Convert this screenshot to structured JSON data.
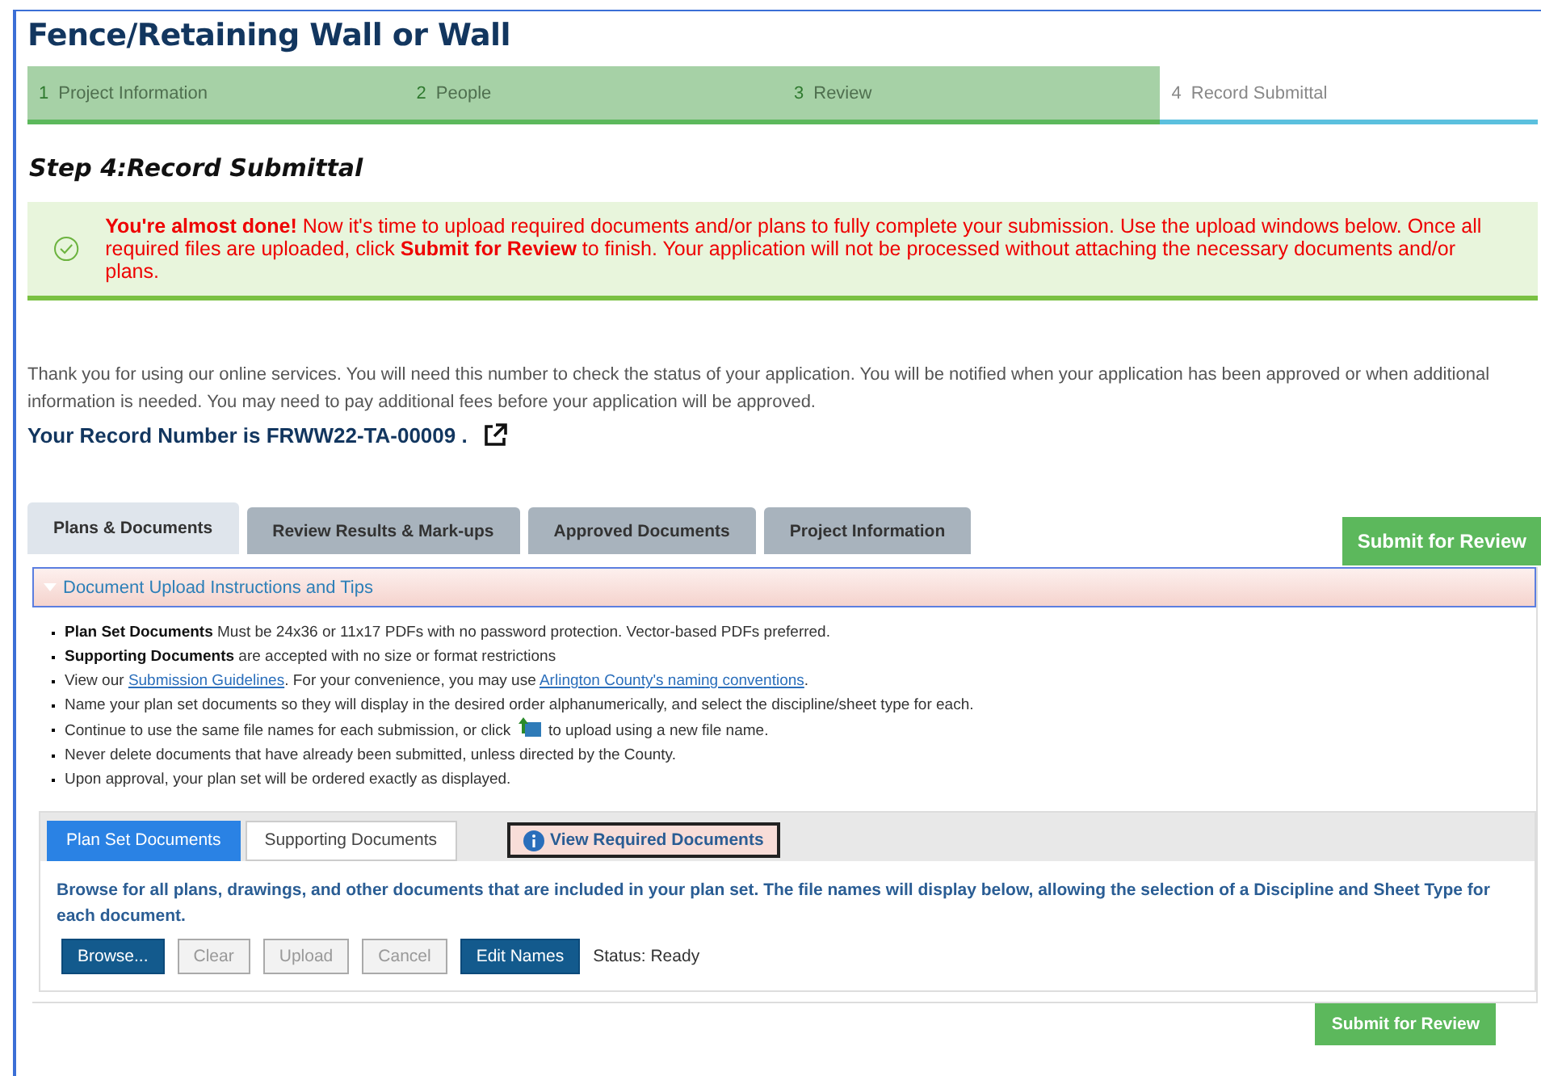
{
  "title": "Fence/Retaining Wall or Wall",
  "steps": [
    {
      "number": "1",
      "label": "Project Information",
      "completed": true
    },
    {
      "number": "2",
      "label": "People",
      "completed": true
    },
    {
      "number": "3",
      "label": "Review",
      "completed": true
    },
    {
      "number": "4",
      "label": "Record Submittal",
      "completed": false
    }
  ],
  "step_heading": "Step 4:Record Submittal",
  "alert": "**You're almost done!** Now it's time to upload required documents and/or plans to fully complete your submission. Use the upload windows below. Once all required files are uploaded, click **Submit for Review** to finish. Your application will not be processed without attaching the necessary documents and/or plans.",
  "intro": "Thank you for using our online services. You will need this number to check the status of your application. You will be notified when your application has been approved or when additional information is needed. You may need to pay additional fees before your application will be approved.",
  "record_number": "Your Record Number is FRWW22-TA-00009 .",
  "tabs": [
    {
      "label": "Plans & Documents",
      "selected": true
    },
    {
      "label": "Review Results & Mark-ups",
      "selected": false
    },
    {
      "label": "Approved Documents",
      "selected": false
    },
    {
      "label": "Project Information",
      "selected": false
    }
  ],
  "submit_top": "Submit for Review",
  "accordion": {
    "title": "Document Upload Instructions and Tips",
    "expanded": true
  },
  "bullets": [
    [
      {
        "kind": "text",
        "text": "**Plan Set Documents** Must be 24x36 or 11x17 PDFs with no password protection. Vector-based PDFs preferred."
      }
    ],
    [
      {
        "kind": "text",
        "text": "**Supporting Documents** are accepted with no size or format restrictions"
      }
    ],
    [
      {
        "kind": "text",
        "text": "View our "
      },
      {
        "kind": "link",
        "text": "Submission Guidelines"
      },
      {
        "kind": "text",
        "text": ". For your convenience, you may use "
      },
      {
        "kind": "link",
        "text": "Arlington County's naming conventions"
      },
      {
        "kind": "text",
        "text": "."
      }
    ],
    [
      {
        "kind": "text",
        "text": "Name your plan set documents so they will display in the desired order alphanumerically, and select the discipline/sheet type for each."
      }
    ],
    [
      {
        "kind": "text",
        "text": "Continue to use the same file names for each submission, or click "
      },
      {
        "kind": "icon"
      },
      {
        "kind": "text",
        "text": " to upload using a new file name."
      }
    ],
    [
      {
        "kind": "text",
        "text": "Never delete documents that have already been submitted, unless directed by the County."
      }
    ],
    [
      {
        "kind": "text",
        "text": "Upon approval, your plan set will be ordered exactly as displayed."
      }
    ]
  ],
  "upload": {
    "tabs": [
      {
        "label": "Plan Set Documents",
        "selected": true
      },
      {
        "label": "Supporting Documents",
        "selected": false
      }
    ],
    "required_button": "View Required Documents",
    "description": "Browse for all plans, drawings, and other documents that are included in your plan set. The file names will display below, allowing the selection of a Discipline and Sheet Type for each document.",
    "buttons": [
      {
        "label": "Browse...",
        "disabled": false
      },
      {
        "label": "Clear",
        "disabled": true
      },
      {
        "label": "Upload",
        "disabled": true
      },
      {
        "label": "Cancel",
        "disabled": true
      },
      {
        "label": "Edit Names",
        "disabled": false
      }
    ],
    "status": "Status: Ready"
  },
  "submit_bottom": "Submit for Review"
}
